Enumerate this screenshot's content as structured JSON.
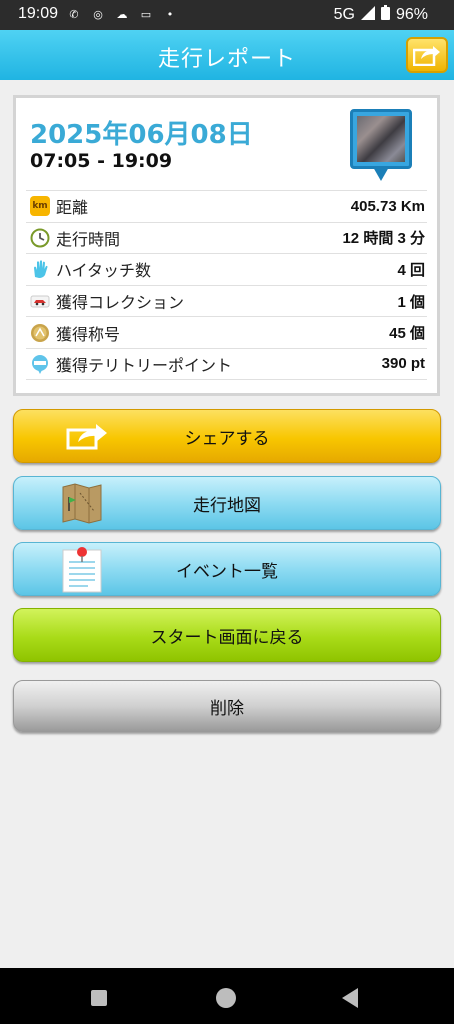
{
  "status": {
    "time": "19:09",
    "network": "5G",
    "battery": "96%"
  },
  "header": {
    "title": "走行レポート"
  },
  "report": {
    "date": "2025年06月08日",
    "time_range": "07:05 - 19:09",
    "rows": [
      {
        "icon": "km-icon",
        "label": "距離",
        "value": "405.73 Km",
        "badge": "km"
      },
      {
        "icon": "clock-icon",
        "label": "走行時間",
        "value": "12 時間 3 分"
      },
      {
        "icon": "hand-icon",
        "label": "ハイタッチ数",
        "value": "4 回"
      },
      {
        "icon": "car-icon",
        "label": "獲得コレクション",
        "value": "1 個"
      },
      {
        "icon": "medal-icon",
        "label": "獲得称号",
        "value": "45 個"
      },
      {
        "icon": "spot-icon",
        "label": "獲得テリトリーポイント",
        "value": "390 pt"
      }
    ]
  },
  "buttons": {
    "share": "シェアする",
    "map": "走行地図",
    "events": "イベント一覧",
    "back": "スタート画面に戻る",
    "delete": "削除"
  },
  "colors": {
    "header": "#20b4e2",
    "date": "#3aaad6",
    "share_button": "#f8c600",
    "map_button": "#8edbf2",
    "start_button": "#a9db18",
    "delete_button": "#d0d0d0"
  }
}
